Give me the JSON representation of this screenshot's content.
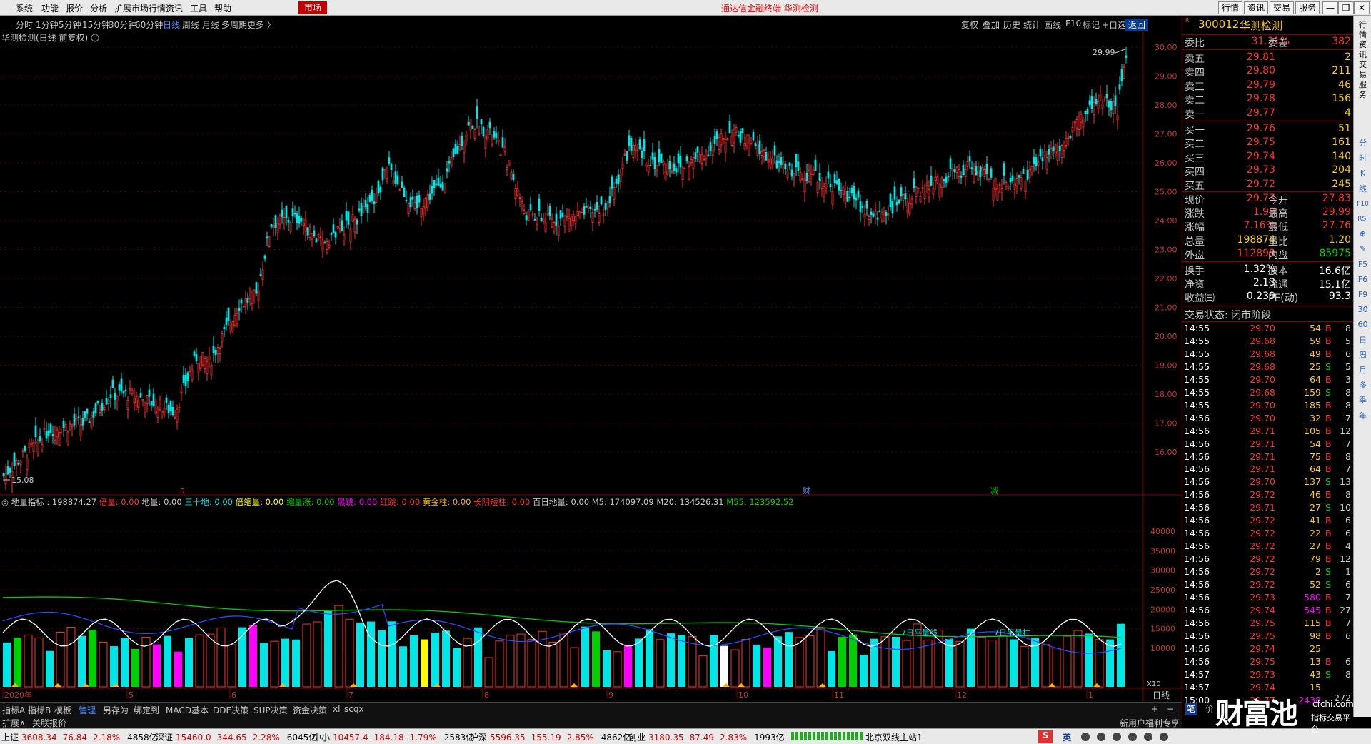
{
  "menu": {
    "items": [
      "系统",
      "功能",
      "报价",
      "分析",
      "扩展市场行情",
      "资讯",
      "工具",
      "帮助"
    ],
    "market": "市场",
    "title": "通达信金融终端  华测检测",
    "right": [
      "行情",
      "资讯",
      "交易",
      "服务"
    ],
    "win": [
      "—",
      "❐",
      "✕"
    ]
  },
  "periods": {
    "items": [
      "分时",
      "1分钟",
      "5分钟",
      "15分钟",
      "30分钟",
      "60分钟",
      "日线",
      "周线",
      "月线",
      "多周期",
      "更多 〉"
    ],
    "active": 6
  },
  "toolbar": {
    "items": [
      "复权",
      "叠加",
      "历史",
      "统计",
      "画线",
      "F10",
      "标记",
      "+自选",
      "返回"
    ],
    "active": 8
  },
  "chart": {
    "title": "华测检测(日线 前复权)",
    "price_labels": [
      "30.00",
      "29.00",
      "28.00",
      "27.00",
      "26.00",
      "25.00",
      "24.00",
      "23.00",
      "22.00",
      "21.00",
      "20.00",
      "19.00",
      "18.00",
      "17.00",
      "16.00"
    ],
    "high_label": "29.99",
    "low_label": "15.08",
    "markers": {
      "s": "S",
      "cai": "财",
      "jian": "减"
    },
    "colors": {
      "up": "#ff3232",
      "down": "#00e6e6"
    }
  },
  "indicator": {
    "name": "地量指标",
    "value": "198874.27",
    "items": [
      {
        "label": "倍量: 0.00",
        "color": "#ff3232"
      },
      {
        "label": "地量: 0.00",
        "color": "#c8c8c8"
      },
      {
        "label": "三十地: 0.00",
        "color": "#00e6e6"
      },
      {
        "label": "倍缩量: 0.00",
        "color": "#ffff00"
      },
      {
        "label": "缩量涨: 0.00",
        "color": "#00d000"
      },
      {
        "label": "黑跳: 0.00",
        "color": "#ff00ff"
      },
      {
        "label": "红跳: 0.00",
        "color": "#ff3232"
      },
      {
        "label": "黄金柱: 0.00",
        "color": "#ffb400"
      },
      {
        "label": "长阴短柱: 0.00",
        "color": "#ff3232"
      },
      {
        "label": "百日地量: 0.00",
        "color": "#c8c8c8"
      },
      {
        "label": "M5: 174097.09",
        "color": "#c8c8c8"
      },
      {
        "label": "M20: 134526.31",
        "color": "#c8c8c8"
      },
      {
        "label": "M55: 123592.52",
        "color": "#00d000"
      }
    ],
    "vol_labels": [
      "40000",
      "35000",
      "30000",
      "25000",
      "20000",
      "15000",
      "10000"
    ],
    "annot1": "7日平量线",
    "annot2": "7日平量柱",
    "x10": "X10",
    "period": "日线"
  },
  "xaxis": {
    "labels": [
      "2020年",
      "5",
      "6",
      "7",
      "8",
      "9",
      "10",
      "11",
      "12",
      "1"
    ]
  },
  "quote": {
    "code": "300012",
    "name": "华测检测",
    "weibi_label": "委比",
    "weibi": "31.31%",
    "weicha_label": "委差",
    "weicha": "382",
    "asks": [
      {
        "label": "卖五",
        "price": "29.81",
        "vol": "2"
      },
      {
        "label": "卖四",
        "price": "29.80",
        "vol": "211"
      },
      {
        "label": "卖三",
        "price": "29.79",
        "vol": "46"
      },
      {
        "label": "卖二",
        "price": "29.78",
        "vol": "156"
      },
      {
        "label": "卖一",
        "price": "29.77",
        "vol": "4"
      }
    ],
    "bids": [
      {
        "label": "买一",
        "price": "29.76",
        "vol": "51"
      },
      {
        "label": "买二",
        "price": "29.75",
        "vol": "161"
      },
      {
        "label": "买三",
        "price": "29.74",
        "vol": "140"
      },
      {
        "label": "买四",
        "price": "29.73",
        "vol": "204"
      },
      {
        "label": "买五",
        "price": "29.72",
        "vol": "245"
      }
    ],
    "stats": [
      {
        "l1": "现价",
        "v1": "29.77",
        "l2": "今开",
        "v2": "27.83",
        "c1": "#ff3232",
        "c2": "#ff3232"
      },
      {
        "l1": "涨跌",
        "v1": "1.99",
        "l2": "最高",
        "v2": "29.99",
        "c1": "#ff3232",
        "c2": "#ff3232"
      },
      {
        "l1": "涨幅",
        "v1": "7.16%",
        "l2": "最低",
        "v2": "27.76",
        "c1": "#ff3232",
        "c2": "#ff3232"
      },
      {
        "l1": "总量",
        "v1": "198874",
        "l2": "量比",
        "v2": "1.20",
        "c1": "#ffd000",
        "c2": "#ffd000"
      },
      {
        "l1": "外盘",
        "v1": "112899",
        "l2": "内盘",
        "v2": "85975",
        "c1": "#ff3232",
        "c2": "#00d000"
      }
    ],
    "fund": [
      {
        "l1": "换手",
        "v1": "1.32%",
        "l2": "股本",
        "v2": "16.6亿"
      },
      {
        "l1": "净资",
        "v1": "2.13",
        "l2": "流通",
        "v2": "15.1亿"
      },
      {
        "l1": "收益㈢",
        "v1": "0.239",
        "l2": "PE(动)",
        "v2": "93.3"
      }
    ],
    "trade_state": "交易状态: 闭市阶段",
    "ticks": [
      [
        "14:55",
        "29.70",
        "54",
        "B",
        "8"
      ],
      [
        "14:55",
        "29.68",
        "59",
        "B",
        "5"
      ],
      [
        "14:55",
        "29.68",
        "49",
        "B",
        "6"
      ],
      [
        "14:55",
        "29.68",
        "25",
        "S",
        "5"
      ],
      [
        "14:55",
        "29.70",
        "64",
        "B",
        "3"
      ],
      [
        "14:55",
        "29.68",
        "159",
        "S",
        "8"
      ],
      [
        "14:55",
        "29.70",
        "185",
        "B",
        "8"
      ],
      [
        "14:56",
        "29.70",
        "32",
        "B",
        "7"
      ],
      [
        "14:56",
        "29.71",
        "105",
        "B",
        "12"
      ],
      [
        "14:56",
        "29.71",
        "54",
        "B",
        "7"
      ],
      [
        "14:56",
        "29.71",
        "75",
        "B",
        "8"
      ],
      [
        "14:56",
        "29.71",
        "64",
        "B",
        "7"
      ],
      [
        "14:56",
        "29.70",
        "137",
        "S",
        "13"
      ],
      [
        "14:56",
        "29.72",
        "46",
        "B",
        "8"
      ],
      [
        "14:56",
        "29.71",
        "27",
        "S",
        "10"
      ],
      [
        "14:56",
        "29.72",
        "41",
        "B",
        "6"
      ],
      [
        "14:56",
        "29.72",
        "22",
        "B",
        "6"
      ],
      [
        "14:56",
        "29.72",
        "27",
        "B",
        "4"
      ],
      [
        "14:56",
        "29.72",
        "79",
        "B",
        "12"
      ],
      [
        "14:56",
        "29.72",
        "2",
        "S",
        "1"
      ],
      [
        "14:56",
        "29.72",
        "52",
        "S",
        "6"
      ],
      [
        "14:56",
        "29.73",
        "580",
        "B",
        "7"
      ],
      [
        "14:56",
        "29.74",
        "545",
        "B",
        "27"
      ],
      [
        "14:56",
        "29.75",
        "115",
        "B",
        "7"
      ],
      [
        "14:56",
        "29.75",
        "98",
        "B",
        "6"
      ],
      [
        "14:56",
        "29.74",
        "25",
        "",
        ""
      ],
      [
        "14:56",
        "29.75",
        "13",
        "B",
        "6"
      ],
      [
        "14:57",
        "29.73",
        "43",
        "S",
        "8"
      ],
      [
        "14:57",
        "29.74",
        "15",
        "",
        ""
      ],
      [
        "15:00",
        "29.77",
        "2438",
        "",
        ""
      ]
    ],
    "last_extra": "272"
  },
  "sidebar": [
    "行",
    "情",
    "资",
    "讯",
    "交",
    "易",
    "服",
    "务",
    "分",
    "时",
    "K",
    "线",
    "F10",
    "RSI",
    "⊕",
    "✎",
    "F5",
    "F6",
    "F9",
    "30",
    "60",
    "日",
    "周",
    "月",
    "多",
    "季",
    "年"
  ],
  "tabs": {
    "items": [
      "指标A",
      "指标B",
      "模板",
      "管理",
      "另存为",
      "绑定到",
      "MACD基本",
      "DDE决策",
      "SUP决策",
      "资金决策",
      "xl",
      "scqx"
    ],
    "active": 3
  },
  "exp": {
    "items": [
      "扩展∧",
      "关联报价"
    ],
    "right": "新用户福利专享",
    "foot": [
      "笔",
      "价"
    ]
  },
  "status": {
    "items": [
      {
        "n": "上证",
        "v": "3608.34",
        "c": "76.84",
        "p": "2.18%",
        "a": "4858亿"
      },
      {
        "n": "深证",
        "v": "15460.0",
        "c": "344.65",
        "p": "2.28%",
        "a": "6045亿"
      },
      {
        "n": "中小",
        "v": "10457.4",
        "c": "184.18",
        "p": "1.79%",
        "a": "2583亿"
      },
      {
        "n": "沪深",
        "v": "5596.35",
        "c": "155.19",
        "p": "2.85%",
        "a": "4862亿"
      },
      {
        "n": "创业",
        "v": "3180.35",
        "c": "87.49",
        "p": "2.83%",
        "a": "1993亿"
      }
    ],
    "server": "北京双线主站1",
    "ime": "英"
  },
  "watermark": {
    "brand": "财富池",
    "url": "cfchi.com",
    "tag": "指标交易平台"
  }
}
